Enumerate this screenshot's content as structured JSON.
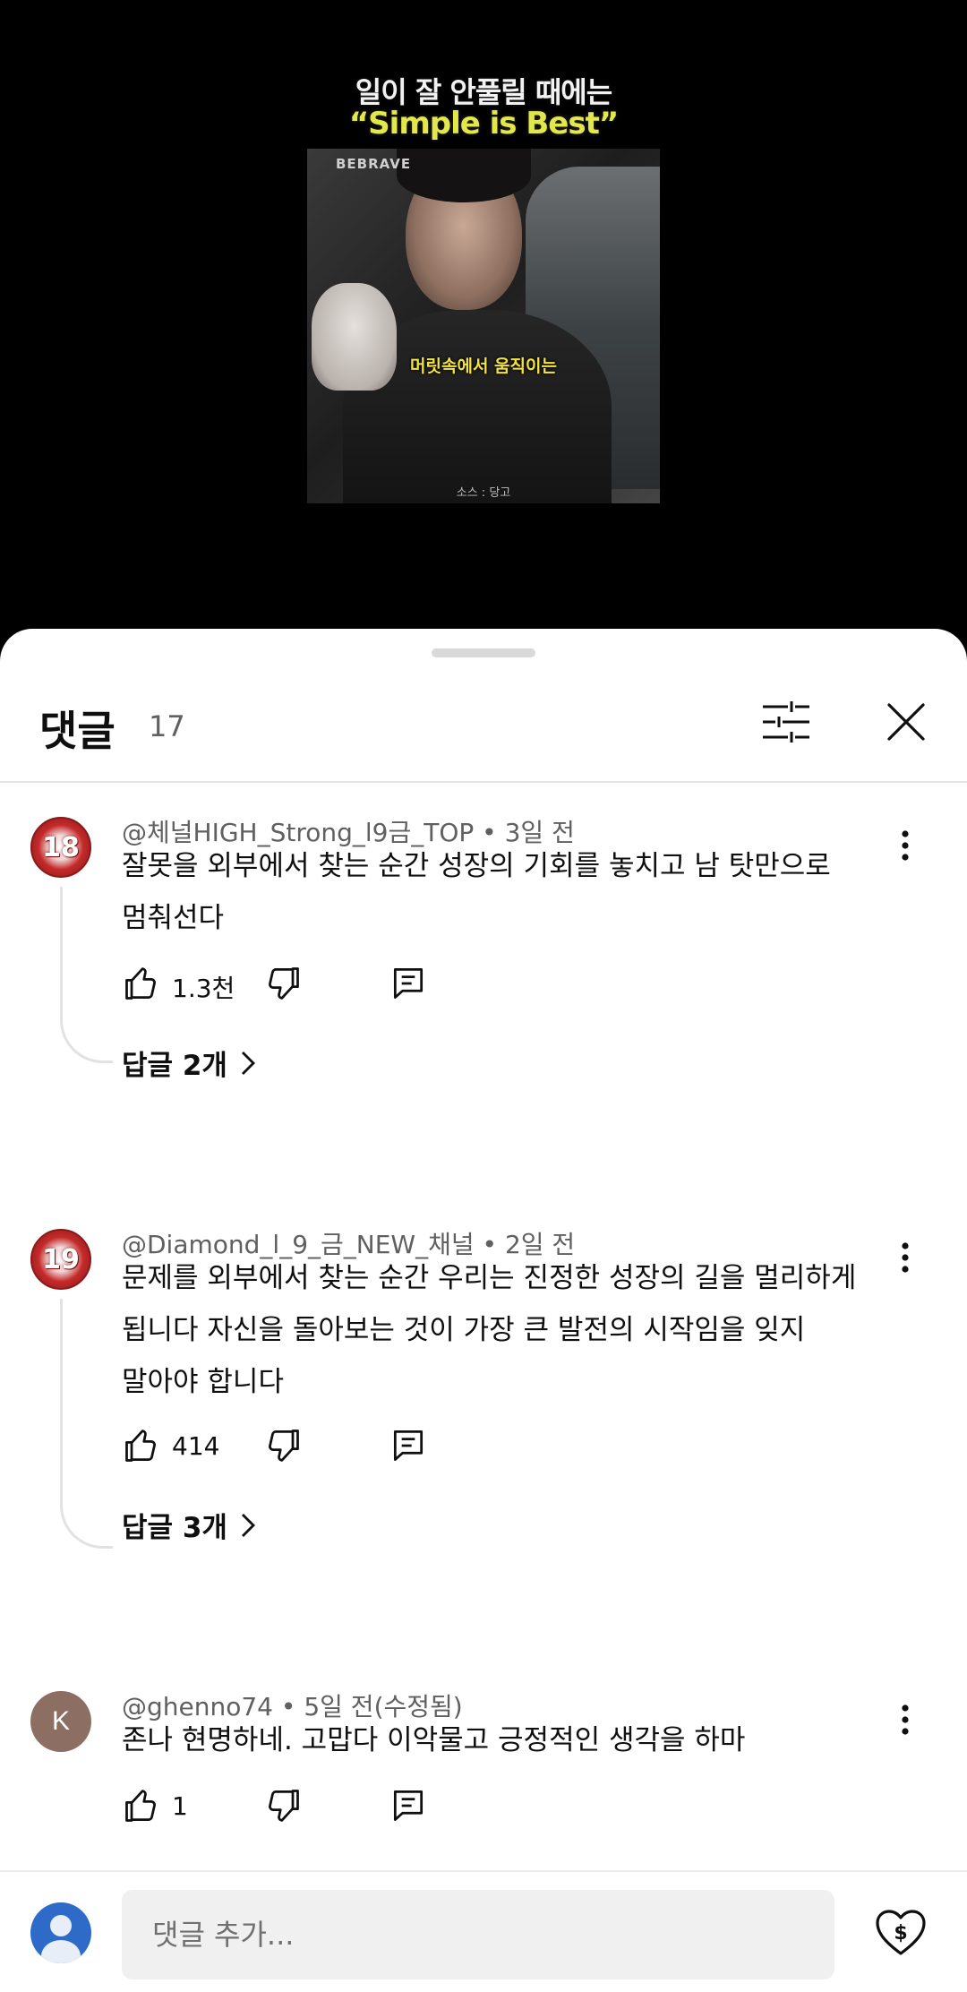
{
  "video": {
    "caption_line1": "일이 잘 안풀릴 때에는",
    "caption_line2": "“Simple is Best”",
    "brand_watermark": "BEBRAVE",
    "subtitle": "머릿속에서 움직이는",
    "source": "소스 : 당고"
  },
  "comments_panel": {
    "title": "댓글",
    "count": "17",
    "filter_icon": "tune-icon",
    "close_icon": "close-icon"
  },
  "comments": [
    {
      "avatar_text": "18",
      "author": "@체널HIGH_Strong_l9금_TOP",
      "time": "3일 전",
      "text": "잘못을 외부에서 찾는 순간 성장의 기회를 놓치고 남 탓만으로\n멈춰선다",
      "likes": "1.3천",
      "replies": "답글 2개"
    },
    {
      "avatar_text": "19",
      "author": "@Diamond_l_9_금_NEW_채널",
      "time": "2일 전",
      "text": "문제를 외부에서 찾는 순간 우리는 진정한 성장의 길을 멀리하게\n됩니다 자신을 돌아보는 것이 가장 큰 발전의 시작임을 잊지\n말아야 합니다",
      "likes": "414",
      "replies": "답글 3개"
    },
    {
      "avatar_text": "K",
      "author": "@ghenno74",
      "time": "5일 전(수정됨)",
      "text": "존나 현명하네. 고맙다 이악물고 긍정적인 생각을 하마",
      "likes": "1"
    }
  ],
  "composer": {
    "placeholder": "댓글 추가...",
    "thanks_icon": "super-thanks-icon"
  },
  "colors": {
    "text_primary": "#0f0f0f",
    "text_secondary": "#606060",
    "sheet_bg": "#ffffff",
    "video_bg": "#000000",
    "self_avatar": "#2e6bc9"
  }
}
